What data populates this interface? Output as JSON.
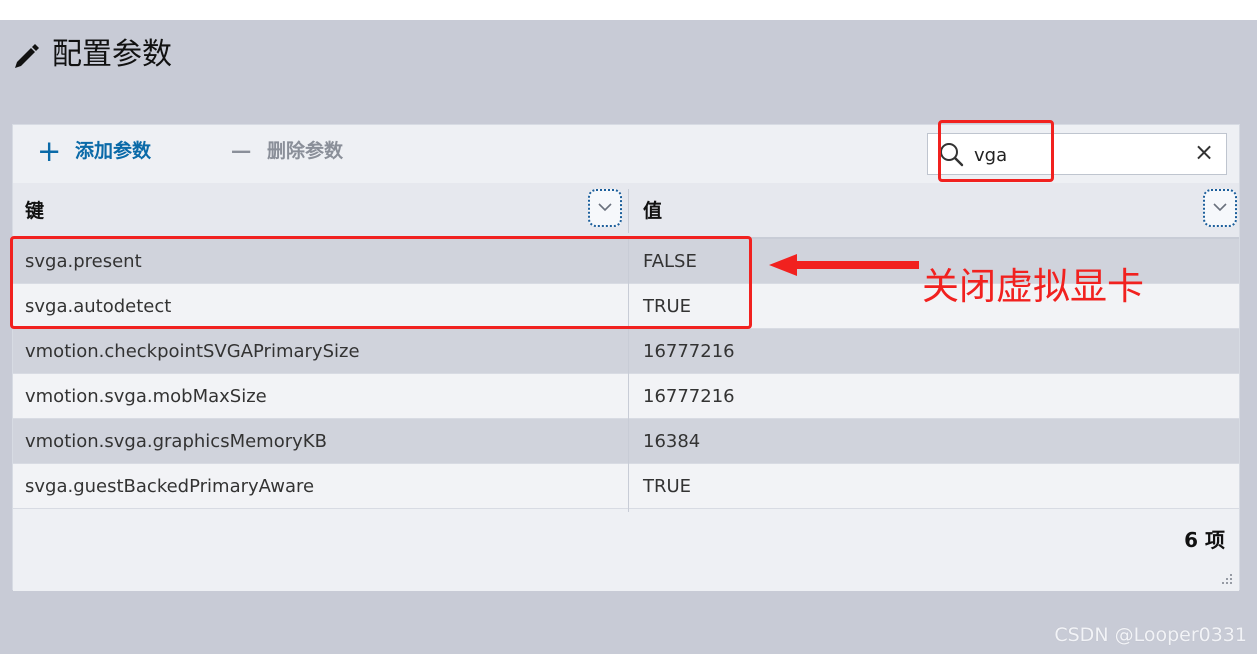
{
  "window": {
    "title": "配置参数"
  },
  "toolbar": {
    "add_label": "添加参数",
    "remove_label": "删除参数",
    "search_value": "vga"
  },
  "table": {
    "columns": {
      "key": "键",
      "value": "值"
    },
    "rows": [
      {
        "key": "svga.present",
        "value": "FALSE"
      },
      {
        "key": "svga.autodetect",
        "value": "TRUE"
      },
      {
        "key": "vmotion.checkpointSVGAPrimarySize",
        "value": "16777216"
      },
      {
        "key": "vmotion.svga.mobMaxSize",
        "value": "16777216"
      },
      {
        "key": "vmotion.svga.graphicsMemoryKB",
        "value": "16384"
      },
      {
        "key": "svga.guestBackedPrimaryAware",
        "value": "TRUE"
      }
    ]
  },
  "footer": {
    "count_label": "6 项"
  },
  "annotation": {
    "text": "关闭虚拟显卡",
    "color": "#f1211f"
  },
  "watermark": {
    "text": "CSDN @Looper0331"
  },
  "icons": {
    "title": "pencil-icon",
    "add": "plus-icon",
    "remove": "minus-icon",
    "search": "search-icon",
    "clear": "close-icon",
    "filter": "chevron-down-icon",
    "resize": "resize-grip-icon"
  },
  "colors": {
    "background": "#c8cbd6",
    "panel": "#eef0f4",
    "accent": "#0a6aa8",
    "highlight": "#f1211f"
  }
}
